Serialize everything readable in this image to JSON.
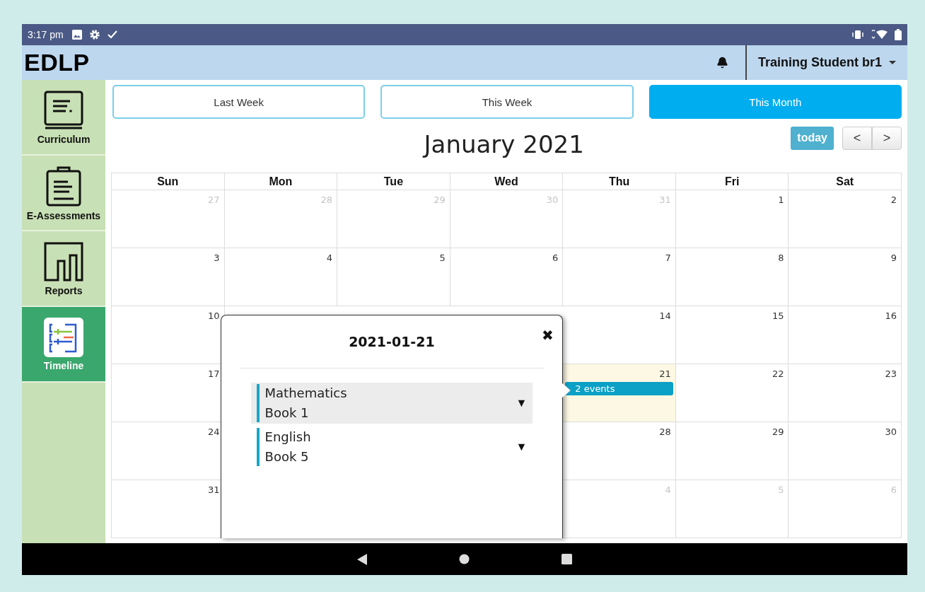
{
  "status_bar": {
    "time": "3:17 pm"
  },
  "header": {
    "logo": "EDLP",
    "user": "Training Student br1"
  },
  "sidebar": {
    "items": [
      {
        "label": "Curriculum",
        "kind": "document",
        "selected": false
      },
      {
        "label": "E-Assessments",
        "kind": "clipboard",
        "selected": false
      },
      {
        "label": "Reports",
        "kind": "chart",
        "selected": false
      },
      {
        "label": "Timeline",
        "kind": "timeline",
        "selected": true
      }
    ]
  },
  "range_tabs": [
    {
      "label": "Last Week",
      "selected": false
    },
    {
      "label": "This Week",
      "selected": false
    },
    {
      "label": "This Month",
      "selected": true
    }
  ],
  "calendar": {
    "title": "January 2021",
    "today_button": "today",
    "prev": "<",
    "next": ">",
    "weekdays": [
      "Sun",
      "Mon",
      "Tue",
      "Wed",
      "Thu",
      "Fri",
      "Sat"
    ],
    "weeks": [
      [
        {
          "n": "27",
          "other_month": true
        },
        {
          "n": "28",
          "other_month": true
        },
        {
          "n": "29",
          "other_month": true
        },
        {
          "n": "30",
          "other_month": true
        },
        {
          "n": "31",
          "other_month": true
        },
        {
          "n": "1",
          "other_month": false
        },
        {
          "n": "2",
          "other_month": false
        }
      ],
      [
        {
          "n": "3",
          "other_month": false
        },
        {
          "n": "4",
          "other_month": false
        },
        {
          "n": "5",
          "other_month": false
        },
        {
          "n": "6",
          "other_month": false
        },
        {
          "n": "7",
          "other_month": false
        },
        {
          "n": "8",
          "other_month": false
        },
        {
          "n": "9",
          "other_month": false
        }
      ],
      [
        {
          "n": "10",
          "other_month": false
        },
        {
          "n": "14",
          "other_month": false
        },
        {
          "n": "15",
          "other_month": false
        },
        {
          "n": "16",
          "other_month": false
        }
      ],
      [
        {
          "n": "17",
          "other_month": false
        },
        {
          "n": "21",
          "other_month": false,
          "today": true,
          "events": [
            "2 events"
          ]
        },
        {
          "n": "22",
          "other_month": false
        },
        {
          "n": "23",
          "other_month": false
        }
      ],
      [
        {
          "n": "24",
          "other_month": false
        },
        {
          "n": "28",
          "other_month": false
        },
        {
          "n": "29",
          "other_month": false
        },
        {
          "n": "30",
          "other_month": false
        }
      ],
      [
        {
          "n": "31",
          "other_month": false
        },
        {
          "n": "4",
          "other_month": true
        },
        {
          "n": "5",
          "other_month": true
        },
        {
          "n": "6",
          "other_month": true
        }
      ]
    ]
  },
  "popover": {
    "date": "2021-01-21",
    "close": "✖",
    "items": [
      {
        "subject": "Mathematics",
        "book": "Book 1",
        "selected": true,
        "toggle": "▼"
      },
      {
        "subject": "English",
        "book": "Book 5",
        "selected": false,
        "toggle": "▼"
      }
    ]
  }
}
